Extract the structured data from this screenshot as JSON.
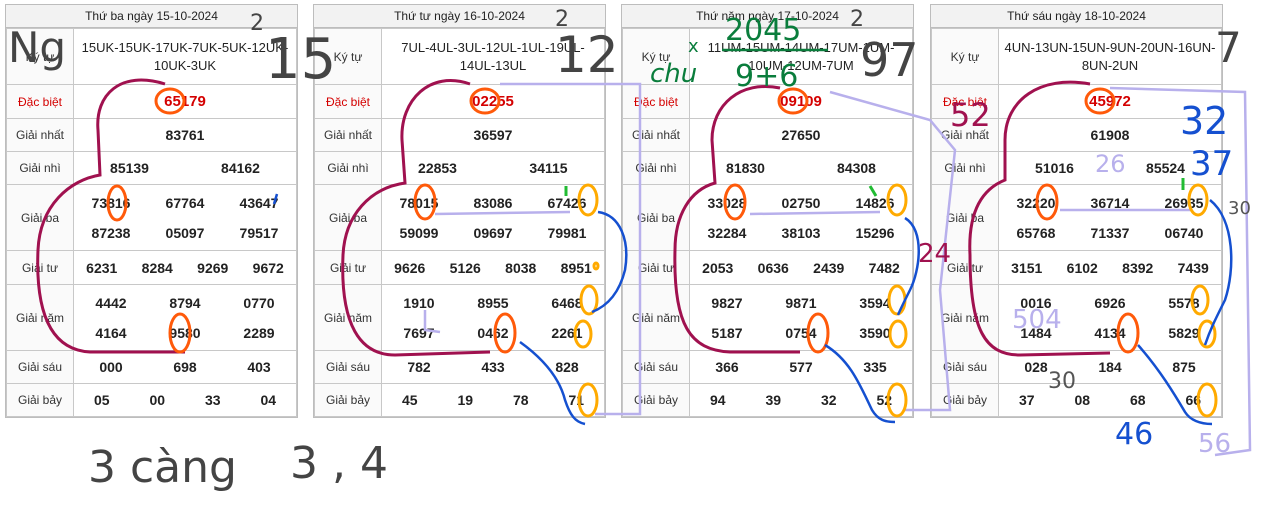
{
  "days": [
    {
      "date_label": "Thứ ba ngày 15-10-2024",
      "ky_tu": "15UK-15UK-17UK-7UK-5UK-12UK-10UK-3UK",
      "dac_biet": "65179",
      "giai_nhat": "83761",
      "giai_nhi": [
        "85139",
        "84162"
      ],
      "giai_ba": [
        "73816",
        "67764",
        "43647",
        "87238",
        "05097",
        "79517"
      ],
      "giai_tu": [
        "6231",
        "8284",
        "9269",
        "9672"
      ],
      "giai_nam": [
        "4442",
        "8794",
        "0770",
        "4164",
        "9580",
        "2289"
      ],
      "giai_sau": [
        "000",
        "698",
        "403"
      ],
      "giai_bay": [
        "05",
        "00",
        "33",
        "04"
      ]
    },
    {
      "date_label": "Thứ tư ngày 16-10-2024",
      "ky_tu": "7UL-4UL-3UL-12UL-1UL-19UL-14UL-13UL",
      "dac_biet": "02255",
      "giai_nhat": "36597",
      "giai_nhi": [
        "22853",
        "34115"
      ],
      "giai_ba": [
        "78015",
        "83086",
        "67426",
        "59099",
        "09697",
        "79981"
      ],
      "giai_tu": [
        "9626",
        "5126",
        "8038",
        "8951"
      ],
      "giai_nam": [
        "1910",
        "8955",
        "6468",
        "7697",
        "0462",
        "2261"
      ],
      "giai_sau": [
        "782",
        "433",
        "828"
      ],
      "giai_bay": [
        "45",
        "19",
        "78",
        "71"
      ]
    },
    {
      "date_label": "Thứ năm ngày 17-10-2024",
      "ky_tu": "11UM-15UM-14UM-17UM-1UM-10UM-12UM-7UM",
      "dac_biet": "09109",
      "giai_nhat": "27650",
      "giai_nhi": [
        "81830",
        "84308"
      ],
      "giai_ba": [
        "33028",
        "02750",
        "14826",
        "32284",
        "38103",
        "15296"
      ],
      "giai_tu": [
        "2053",
        "0636",
        "2439",
        "7482"
      ],
      "giai_nam": [
        "9827",
        "9871",
        "3594",
        "5187",
        "0754",
        "3590"
      ],
      "giai_sau": [
        "366",
        "577",
        "335"
      ],
      "giai_bay": [
        "94",
        "39",
        "32",
        "52"
      ]
    },
    {
      "date_label": "Thứ sáu ngày 18-10-2024",
      "ky_tu": "4UN-13UN-15UN-9UN-20UN-16UN-8UN-2UN",
      "dac_biet": "45972",
      "giai_nhat": "61908",
      "giai_nhi": [
        "51016",
        "85524"
      ],
      "giai_ba": [
        "32220",
        "36714",
        "26935",
        "65768",
        "71337",
        "06740"
      ],
      "giai_tu": [
        "3151",
        "6102",
        "8392",
        "7439"
      ],
      "giai_nam": [
        "0016",
        "6926",
        "5578",
        "1484",
        "4134",
        "5829"
      ],
      "giai_sau": [
        "028",
        "184",
        "875"
      ],
      "giai_bay": [
        "37",
        "08",
        "68",
        "66"
      ]
    }
  ],
  "labels": {
    "ky_tu": "Ký tự",
    "dac_biet": "Đặc biệt",
    "giai_nhat": "Giải nhất",
    "giai_nhi": "Giải nhì",
    "giai_ba": "Giải ba",
    "giai_tu": "Giải tư",
    "giai_nam": "Giải năm",
    "giai_sau": "Giải sáu",
    "giai_bay": "Giải bảy"
  },
  "annotations": {
    "left_ng": "Ng",
    "n15": "15",
    "sup_2a": "2",
    "n12": "12",
    "sup_2b": "2",
    "green_chu": "chu",
    "green_x": "x",
    "green_top": "2045",
    "green_bottom": "9+6",
    "sup_2c": "2",
    "n97": "97",
    "sup_7": "7",
    "n52": "52",
    "n32": "32",
    "n37": "37",
    "n26": "26",
    "n24": "24",
    "n30": "30",
    "n504": "504",
    "n30b": "30",
    "n46": "46",
    "n56": "56",
    "bottom_left": "3 càng",
    "bottom_nums": "3 , 4"
  },
  "colors": {
    "special": "#d40000",
    "ink_maroon": "#a0114f",
    "ink_orange": "#ff5a0a",
    "ink_yellow": "#ffaa00",
    "ink_blue": "#1550d0",
    "ink_lavender": "#b8b0ec",
    "ink_green": "#0a7d3c",
    "ink_gray": "#555555"
  }
}
